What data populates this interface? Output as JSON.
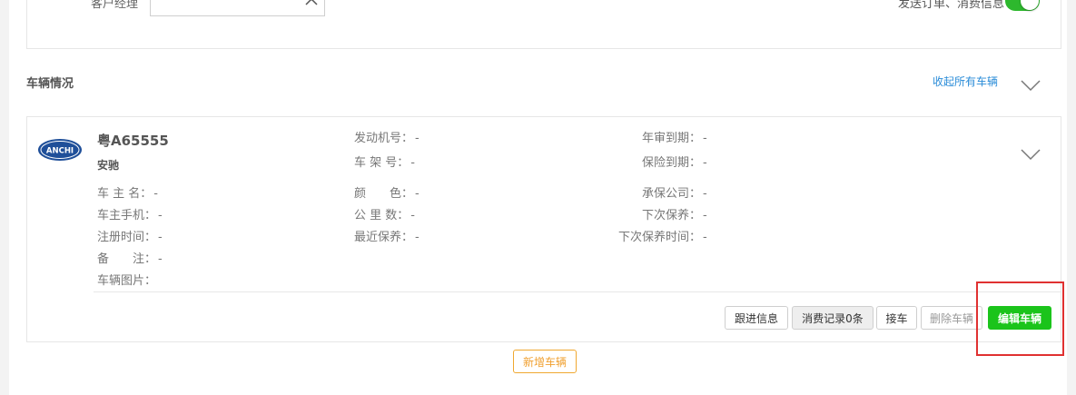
{
  "top": {
    "manager_label": "客户经理",
    "manager_value": "",
    "notify_label": "发送订单、消费信息",
    "notify_on": true
  },
  "section": {
    "title": "车辆情况",
    "collapse_all": "收起所有车辆"
  },
  "vehicle": {
    "logo_text": "ANCHI",
    "plate": "粤A65555",
    "brand": "安驰",
    "fields": {
      "engine_no": {
        "label": "发动机号：",
        "value": "-"
      },
      "frame_no": {
        "label": "车 架 号：",
        "value": "-"
      },
      "inspection": {
        "label": "年审到期：",
        "value": "-"
      },
      "insurance": {
        "label": "保险到期：",
        "value": "-"
      },
      "owner": {
        "label": "车 主 名：",
        "value": "-"
      },
      "owner_phone": {
        "label": "车主手机：",
        "value": "-"
      },
      "reg_time": {
        "label": "注册时间：",
        "value": "-"
      },
      "remark": {
        "label": "备　　注：",
        "value": "-"
      },
      "photos": {
        "label": "车辆图片：",
        "value": ""
      },
      "color": {
        "label": "颜　　色：",
        "value": "-"
      },
      "mileage": {
        "label": "公 里 数：",
        "value": "-"
      },
      "last_maint": {
        "label": "最近保养：",
        "value": "-"
      },
      "insurer": {
        "label": "承保公司：",
        "value": "-"
      },
      "next_maint": {
        "label": "下次保养：",
        "value": "-"
      },
      "next_maint_time": {
        "label": "下次保养时间：",
        "value": "-"
      }
    },
    "actions": {
      "follow_up": "跟进信息",
      "consumption": "消费记录0条",
      "pickup": "接车",
      "delete": "删除车辆",
      "edit": "编辑车辆"
    }
  },
  "add_vehicle": "新增车辆",
  "colors": {
    "toggle_on": "#2db82d",
    "primary_button": "#1bc41b",
    "link": "#2a8cd8",
    "add_button": "#f0a030",
    "highlight": "#e03131"
  }
}
